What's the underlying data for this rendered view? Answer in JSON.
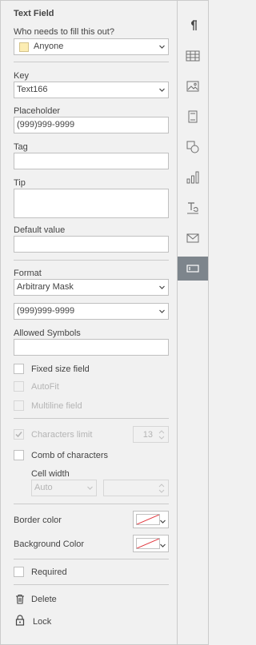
{
  "panel": {
    "title": "Text Field",
    "who_label": "Who needs to fill this out?",
    "who_value": "Anyone",
    "key_label": "Key",
    "key_value": "Text166",
    "placeholder_label": "Placeholder",
    "placeholder_value": "(999)999-9999",
    "tag_label": "Tag",
    "tag_value": "",
    "tip_label": "Tip",
    "tip_value": "",
    "default_label": "Default value",
    "default_value": "",
    "format_label": "Format",
    "format_value": "Arbitrary Mask",
    "mask_value": "(999)999-9999",
    "allowed_label": "Allowed Symbols",
    "allowed_value": "",
    "fixed_size_label": "Fixed size field",
    "autofit_label": "AutoFit",
    "multiline_label": "Multiline field",
    "char_limit_label": "Characters limit",
    "char_limit_value": "13",
    "comb_label": "Comb of characters",
    "cell_width_label": "Cell width",
    "cell_width_value": "Auto",
    "border_color_label": "Border color",
    "bg_color_label": "Background Color",
    "required_label": "Required",
    "delete_label": "Delete",
    "lock_label": "Lock"
  },
  "state": {
    "fixed_size": false,
    "autofit": false,
    "multiline": false,
    "char_limit": true,
    "comb": false,
    "required": false
  },
  "colors": {
    "who_swatch": "#fcedb3",
    "active_rail": "#7d858c",
    "no_color_slash": "#e0333a"
  },
  "rail": {
    "items": [
      {
        "icon": "paragraph-icon"
      },
      {
        "icon": "table-icon"
      },
      {
        "icon": "image-icon"
      },
      {
        "icon": "header-footer-icon"
      },
      {
        "icon": "shape-icon"
      },
      {
        "icon": "chart-icon"
      },
      {
        "icon": "text-art-icon"
      },
      {
        "icon": "mail-merge-icon"
      },
      {
        "icon": "form-field-icon"
      }
    ],
    "active_index": 8
  }
}
